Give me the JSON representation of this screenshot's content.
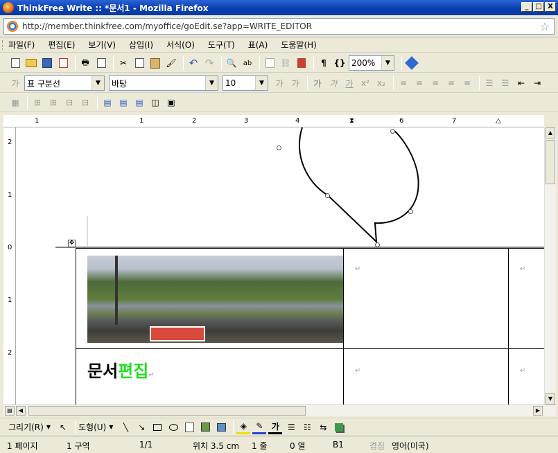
{
  "window": {
    "title": "ThinkFree Write :: *문서1 - Mozilla Firefox",
    "minimize": "_",
    "maximize": "□",
    "close": "X"
  },
  "address": {
    "url": "http://member.thinkfree.com/myoffice/goEdit.se?app=WRITE_EDITOR"
  },
  "menu": [
    "파일(F)",
    "편집(E)",
    "보기(V)",
    "삽입(I)",
    "서식(O)",
    "도구(T)",
    "표(A)",
    "도움말(H)"
  ],
  "toolbar": {
    "zoom": "200%",
    "style": "표 구분선",
    "font": "바탕",
    "size": "10",
    "bold_label": "가",
    "italic_label": "가",
    "underline_label": "가",
    "sup_label": "x²",
    "sub_label": "x₂"
  },
  "ruler": {
    "h_labels": [
      "1",
      "1",
      "2",
      "3",
      "4",
      "5",
      "6",
      "7"
    ],
    "v_labels": [
      "2",
      "1",
      "0",
      "1",
      "2"
    ]
  },
  "document": {
    "heading_black": "문서",
    "heading_green": "편집",
    "colors": {
      "heading_green": "#22dd22",
      "heading_black": "#000000"
    }
  },
  "draw_toolbar": {
    "draw_menu": "그리기(R)",
    "shape_menu": "도형(U)"
  },
  "status": {
    "page": "1 페이지",
    "section": "1 구역",
    "page_of": "1/1",
    "position": "위치 3.5 cm",
    "line": "1 줄",
    "column": "0 열",
    "cell": "B1",
    "mode": "겹침",
    "language": "영어(미국)"
  }
}
